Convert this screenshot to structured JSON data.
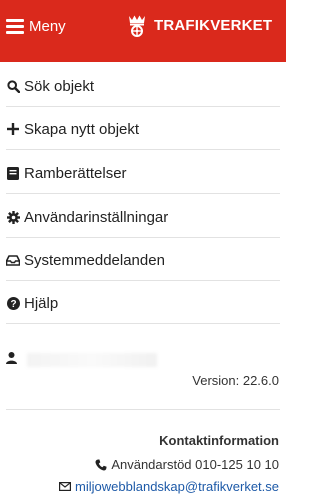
{
  "header": {
    "menu_label": "Meny",
    "brand_name": "TRAFIKVERKET",
    "background_color": "#da291c"
  },
  "nav": {
    "items": [
      {
        "icon": "search-icon",
        "label": "Sök objekt"
      },
      {
        "icon": "plus-icon",
        "label": "Skapa nytt objekt"
      },
      {
        "icon": "book-icon",
        "label": "Ramberättelser"
      },
      {
        "icon": "gear-icon",
        "label": "Användarinställningar"
      },
      {
        "icon": "inbox-icon",
        "label": "Systemmeddelanden"
      },
      {
        "icon": "question-circle-icon",
        "label": "Hjälp"
      }
    ]
  },
  "user": {
    "icon": "user-icon",
    "version": "Version: 22.6.0"
  },
  "contact": {
    "title": "Kontaktinformation",
    "phone": "Användarstöd 010-125 10 10",
    "email": "miljowebblandskap@trafikverket.se",
    "link_color": "#1e5aa8"
  }
}
